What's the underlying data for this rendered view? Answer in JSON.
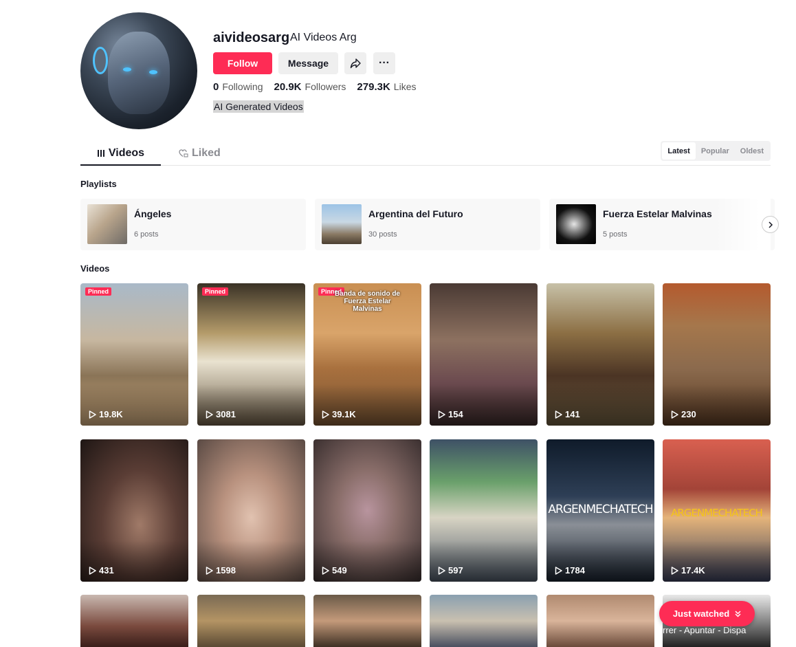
{
  "profile": {
    "username": "aivideosarg",
    "nickname": "AI Videos Arg",
    "follow_label": "Follow",
    "message_label": "Message",
    "more_label": "···",
    "following_count": "0",
    "following_label": "Following",
    "followers_count": "20.9K",
    "followers_label": "Followers",
    "likes_count": "279.3K",
    "likes_label": "Likes",
    "bio": "AI Generated Videos"
  },
  "tabs": {
    "videos": "Videos",
    "liked": "Liked"
  },
  "sort": [
    "Latest",
    "Popular",
    "Oldest"
  ],
  "playlists_title": "Playlists",
  "playlists": [
    {
      "name": "Ángeles",
      "count": "6 posts"
    },
    {
      "name": "Argentina del Futuro",
      "count": "30 posts"
    },
    {
      "name": "Fuerza Estelar Malvinas",
      "count": "5 posts"
    }
  ],
  "videos_title": "Videos",
  "pinned_label": "Pinned",
  "videos": [
    {
      "views": "19.8K"
    },
    {
      "views": "3081"
    },
    {
      "views": "39.1K",
      "overlay": "Banda de sonido de Fuerza Estelar Malvinas"
    },
    {
      "views": "154"
    },
    {
      "views": "141"
    },
    {
      "views": "230"
    },
    {
      "views": "431"
    },
    {
      "views": "1598"
    },
    {
      "views": "549"
    },
    {
      "views": "597"
    },
    {
      "views": "1784",
      "overlay": "ARGENMECHATECH"
    },
    {
      "views": "17.4K",
      "overlay": "ARGENMECHATECH"
    }
  ],
  "partial_overlay": "rrer - Apuntar - Dispa",
  "just_watched_label": "Just watched",
  "colors": {
    "accent": "#fe2c55",
    "text": "#161823",
    "muted": "#8a8b91"
  }
}
